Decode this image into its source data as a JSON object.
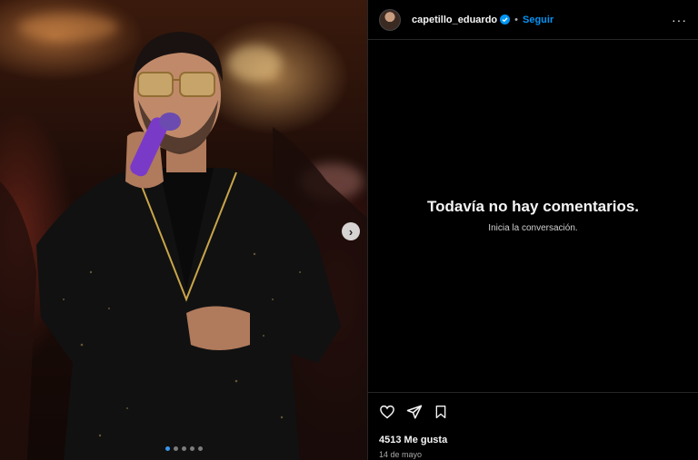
{
  "post": {
    "username": "capetillo_eduardo",
    "separator": "•",
    "follow_label": "Seguir",
    "more_label": "···"
  },
  "comments": {
    "empty_title": "Todavía no hay comentarios.",
    "empty_subtitle": "Inicia la conversación."
  },
  "engagement": {
    "likes": "4513 Me gusta",
    "date": "14 de mayo"
  },
  "carousel": {
    "next_label": "›",
    "slide_count": 5,
    "active_index": 0
  },
  "colors": {
    "follow": "#0095f6",
    "verified": "#0095f6",
    "background": "#000000",
    "border": "#262626",
    "active_dot": "#3897f0"
  },
  "icons": {
    "heart": "heart-icon",
    "share": "send-icon",
    "bookmark": "bookmark-icon",
    "verified": "verified-badge-icon",
    "more": "more-options-icon",
    "carousel_next": "chevron-right-icon"
  }
}
